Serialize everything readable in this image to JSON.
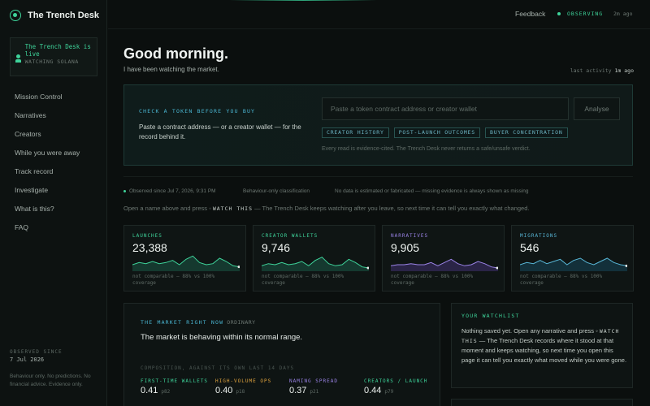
{
  "brand": {
    "name": "The Trench Desk"
  },
  "live_card": {
    "title": "The Trench Desk is live",
    "subtitle": "WATCHING SOLANA"
  },
  "nav": [
    "Mission Control",
    "Narratives",
    "Creators",
    "While you were away",
    "Track record",
    "Investigate",
    "What is this?",
    "FAQ"
  ],
  "sidebar_footer": {
    "label": "OBSERVED SINCE",
    "date": "7 Jul 2026",
    "note": "Behaviour only. No predictions. No financial advice. Evidence only."
  },
  "topbar": {
    "feedback": "Feedback",
    "status": "OBSERVING",
    "time": "2m ago"
  },
  "header": {
    "greeting": "Good morning.",
    "subtitle": "I have been watching the market.",
    "last_activity_label": "last activity",
    "last_activity_time": "1m ago"
  },
  "check": {
    "label": "CHECK A TOKEN BEFORE YOU BUY",
    "description": "Paste a contract address — or a creator wallet — for the record behind it.",
    "placeholder": "Paste a token contract address or creator wallet",
    "button": "Analyse",
    "chips": [
      "CREATOR HISTORY",
      "POST-LAUNCH OUTCOMES",
      "BUYER CONCENTRATION"
    ],
    "footnote": "Every read is evidence-cited. The Trench Desk never returns a safe/unsafe verdict."
  },
  "status_row": {
    "observed": "Observed since Jul 7, 2026, 9:31 PM",
    "classification": "Behaviour-only classification",
    "disclaimer": "No data is estimated or fabricated — missing evidence is always shown as missing"
  },
  "watch_note": {
    "before": "Open a name above and press",
    "keyword": "WATCH THIS",
    "after": "— The Trench Desk keeps watching after you leave, so next time it can tell you exactly what changed."
  },
  "stats": [
    {
      "label": "LAUNCHES",
      "value": "23,388",
      "note": "not comparable — 88% vs 100% coverage",
      "color": "#3ed39a",
      "fill": "#15392f",
      "spark": [
        6,
        8,
        7,
        9,
        7,
        8,
        10,
        6,
        11,
        14,
        8,
        6,
        7,
        12,
        9,
        5,
        4
      ]
    },
    {
      "label": "CREATOR WALLETS",
      "value": "9,746",
      "note": "not comparable — 88% vs 100% coverage",
      "color": "#3ed39a",
      "fill": "#15392f",
      "spark": [
        5,
        7,
        6,
        8,
        6,
        7,
        9,
        5,
        10,
        13,
        7,
        5,
        6,
        11,
        8,
        4,
        3
      ]
    },
    {
      "label": "NARRATIVES",
      "value": "9,905",
      "note": "not comparable — 88% vs 100% coverage",
      "color": "#9a83e6",
      "fill": "#2a2446",
      "spark": [
        5,
        6,
        6,
        7,
        6,
        6,
        8,
        5,
        8,
        11,
        7,
        5,
        6,
        9,
        7,
        4,
        3
      ]
    },
    {
      "label": "MIGRATIONS",
      "value": "546",
      "note": "not comparable — 88% vs 100% coverage",
      "color": "#58b6d6",
      "fill": "#13303a",
      "spark": [
        6,
        8,
        7,
        10,
        7,
        9,
        11,
        6,
        10,
        12,
        8,
        6,
        9,
        12,
        8,
        6,
        5
      ]
    }
  ],
  "market": {
    "label": "THE MARKET RIGHT NOW",
    "badge": "ORDINARY",
    "text": "The market is behaving within its normal range.",
    "composition": "COMPOSITION, AGAINST ITS OWN LAST 14 DAYS",
    "metrics": [
      {
        "label": "FIRST-TIME WALLETS",
        "value": "0.41",
        "pct": "p82",
        "color": "#3ed39a"
      },
      {
        "label": "HIGH-VOLUME OPS",
        "value": "0.40",
        "pct": "p18",
        "color": "#e0a33e"
      },
      {
        "label": "NAMING SPREAD",
        "value": "0.37",
        "pct": "p21",
        "color": "#9a83e6"
      },
      {
        "label": "CREATORS / LAUNCH",
        "value": "0.44",
        "pct": "p79",
        "color": "#3ed39a"
      }
    ]
  },
  "watchlist": {
    "label": "YOUR WATCHLIST",
    "before": "Nothing saved yet. Open any narrative and press",
    "keyword": "WATCH THIS",
    "after": "— The Trench Desk records where it stood at that moment and keeps watching, so next time you open this page it can tell you exactly what moved while you were gone."
  }
}
